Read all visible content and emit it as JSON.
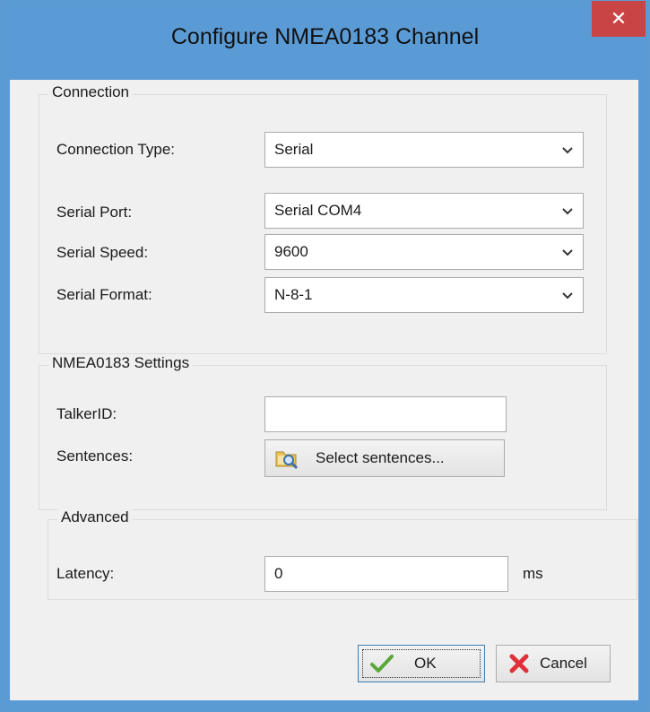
{
  "window": {
    "title": "Configure NMEA0183 Channel",
    "close_icon": "close-icon",
    "accent_color": "#5b9bd5",
    "close_color": "#c94444"
  },
  "connection": {
    "legend": "Connection",
    "type_label": "Connection Type:",
    "type_value": "Serial",
    "port_label": "Serial Port:",
    "port_value": "Serial COM4",
    "speed_label": "Serial Speed:",
    "speed_value": "9600",
    "format_label": "Serial Format:",
    "format_value": "N-8-1"
  },
  "nmea": {
    "legend": "NMEA0183 Settings",
    "talker_label": "TalkerID:",
    "talker_value": "",
    "sentences_label": "Sentences:",
    "select_button": "Select sentences...",
    "select_icon": "folder-search-icon"
  },
  "advanced": {
    "legend": "Advanced",
    "latency_label": "Latency:",
    "latency_value": "0",
    "latency_unit": "ms"
  },
  "buttons": {
    "ok": "OK",
    "ok_icon": "checkmark-icon",
    "cancel": "Cancel",
    "cancel_icon": "x-icon"
  }
}
